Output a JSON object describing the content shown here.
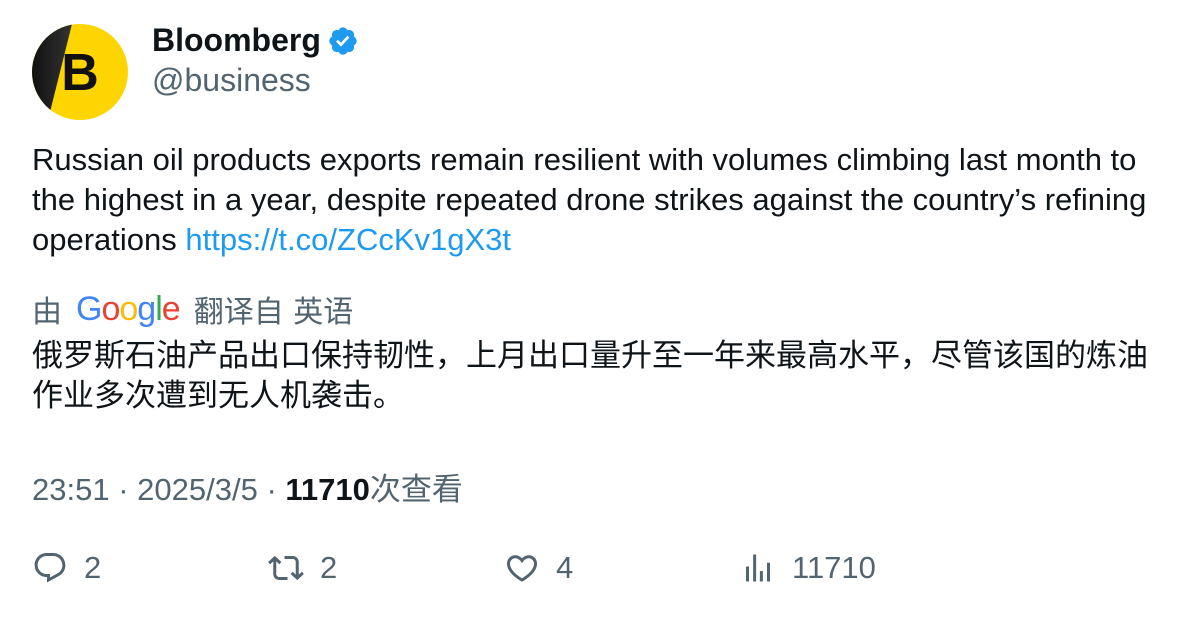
{
  "author": {
    "display_name": "Bloomberg",
    "handle": "@business",
    "avatar_letter": "B",
    "verified": true,
    "avatar_color": "#ffd500",
    "verified_color": "#1d9bf0"
  },
  "tweet": {
    "text": "Russian oil products exports remain resilient with volumes climbing last month to the highest in a year, despite repeated drone strikes against the country’s refining operations ",
    "link": "https://t.co/ZCcKv1gX3t",
    "link_color": "#1d9bf0"
  },
  "translation": {
    "prefix": "由",
    "provider_logo": "Google",
    "suffix": "翻译自 英语",
    "text": "俄罗斯石油产品出口保持韧性，上月出口量升至一年来最高水平，尽管该国的炼油作业多次遭到无人机袭击。"
  },
  "meta": {
    "time": "23:51",
    "separator": "·",
    "date": "2025/3/5",
    "views_count": "11710",
    "views_label": "次查看"
  },
  "actions": {
    "replies": "2",
    "retweets": "2",
    "likes": "4",
    "views": "11710"
  },
  "icons": {
    "reply": "reply-icon",
    "retweet": "retweet-icon",
    "like": "heart-icon",
    "views": "analytics-icon",
    "verified": "verified-badge-icon"
  }
}
